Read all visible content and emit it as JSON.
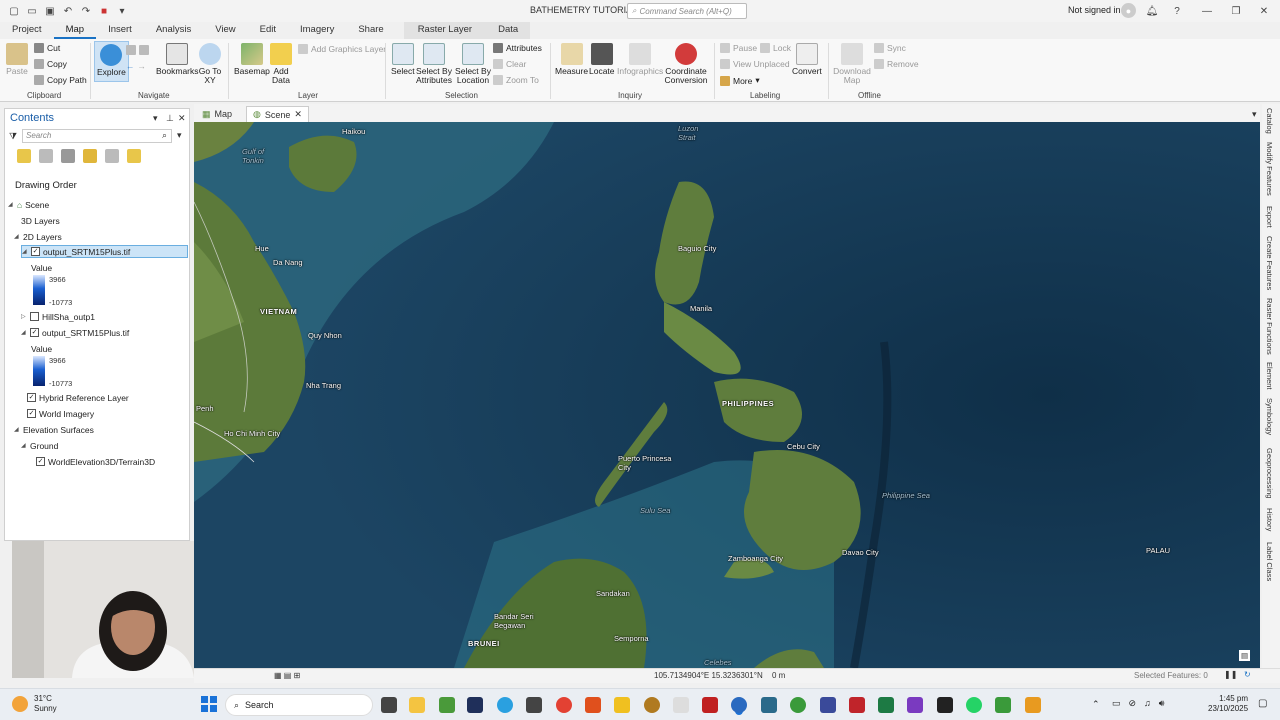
{
  "app": {
    "title": "BATHEMETRY TUTORIAL",
    "search_placeholder": "Command Search (Alt+Q)",
    "signin": "Not signed in"
  },
  "tabs": [
    "Project",
    "Map",
    "Insert",
    "Analysis",
    "View",
    "Edit",
    "Imagery",
    "Share",
    "Raster Layer",
    "Data"
  ],
  "ribbon": {
    "paste": "Paste",
    "cut": "Cut",
    "copy": "Copy",
    "copy_path": "Copy Path",
    "clipboard": "Clipboard",
    "explore": "Explore",
    "bookmarks": "Bookmarks",
    "go_to_xy": "Go To XY",
    "navigate": "Navigate",
    "basemap": "Basemap",
    "add_data": "Add Data",
    "add_graphics_layer": "Add Graphics Layer",
    "layer": "Layer",
    "select": "Select",
    "select_by_attributes": "Select By Attributes",
    "select_by_location": "Select By Location",
    "attributes": "Attributes",
    "clear": "Clear",
    "zoom_to": "Zoom To",
    "selection": "Selection",
    "measure": "Measure",
    "locate": "Locate",
    "infographics": "Infographics",
    "coordinate_conversion": "Coordinate Conversion",
    "inquiry": "Inquiry",
    "pause": "Pause",
    "lock": "Lock",
    "view_unplaced": "View Unplaced",
    "more": "More",
    "convert": "Convert",
    "labeling": "Labeling",
    "download_map": "Download Map",
    "sync": "Sync",
    "remove": "Remove",
    "offline": "Offline"
  },
  "contents": {
    "title": "Contents",
    "search_placeholder": "Search",
    "drawing_order": "Drawing Order",
    "scene": "Scene",
    "layers_3d": "3D Layers",
    "layers_2d": "2D Layers",
    "layer1": "output_SRTM15Plus.tif",
    "value_label": "Value",
    "max": "3966",
    "min": "-10773",
    "hillshade": "HillSha_outp1",
    "layer2": "output_SRTM15Plus.tif",
    "value_label2": "Value",
    "max2": "3966",
    "min2": "-10773",
    "hybrid": "Hybrid Reference Layer",
    "imagery": "World Imagery",
    "elevation": "Elevation Surfaces",
    "ground": "Ground",
    "terrain": "WorldElevation3D/Terrain3D"
  },
  "view_tabs": [
    "Map",
    "Scene"
  ],
  "map_labels": {
    "haikou": "Haikou",
    "gulf": "Gulf of Tonkin",
    "luzon_strait": "Luzon Strait",
    "baguio": "Baguio City",
    "hue": "Hue",
    "da_nang": "Da Nang",
    "manila": "Manila",
    "vietnam": "VIETNAM",
    "quy_nhon": "Quy Nhon",
    "nha_trang": "Nha Trang",
    "philippines": "PHILIPPINES",
    "penh": "Penh",
    "hcmc": "Ho Chi Minh City",
    "cebu": "Cebu City",
    "puerto_princesa": "Puerto Princesa City",
    "sulu_sea": "Sulu Sea",
    "philippine_sea": "Philippine Sea",
    "davao": "Davao City",
    "palau": "PALAU",
    "zamboanga": "Zamboanga City",
    "sandakan": "Sandakan",
    "bandar": "Bandar Seri Begawan",
    "brunei": "BRUNEI",
    "semporna": "Semporna",
    "celebes": "Celebes"
  },
  "right_panels": [
    "Catalog",
    "Modify Features",
    "Export",
    "Create Features",
    "Raster Functions",
    "Element",
    "Symbology",
    "Geoprocessing",
    "History",
    "Label Class"
  ],
  "status": {
    "coords": "105.7134904°E 15.3236301°N",
    "elev": "0 m",
    "selected": "Selected Features: 0"
  },
  "taskbar": {
    "weather_temp": "31°C",
    "weather_desc": "Sunny",
    "search": "Search",
    "time": "1:45 pm",
    "date": "23/10/2025"
  }
}
